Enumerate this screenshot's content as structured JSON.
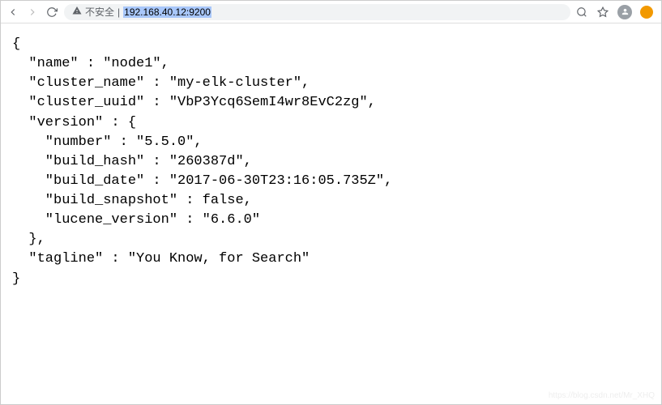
{
  "address_bar": {
    "security_label": "不安全",
    "url": "192.168.40.12:9200"
  },
  "json_response": {
    "line1": "{",
    "line2": "  \"name\" : \"node1\",",
    "line3": "  \"cluster_name\" : \"my-elk-cluster\",",
    "line4": "  \"cluster_uuid\" : \"VbP3Ycq6SemI4wr8EvC2zg\",",
    "line5": "  \"version\" : {",
    "line6": "    \"number\" : \"5.5.0\",",
    "line7": "    \"build_hash\" : \"260387d\",",
    "line8": "    \"build_date\" : \"2017-06-30T23:16:05.735Z\",",
    "line9": "    \"build_snapshot\" : false,",
    "line10": "    \"lucene_version\" : \"6.6.0\"",
    "line11": "  },",
    "line12": "  \"tagline\" : \"You Know, for Search\"",
    "line13": "}"
  },
  "watermark": "https://blog.csdn.net/Mr_XHQ"
}
